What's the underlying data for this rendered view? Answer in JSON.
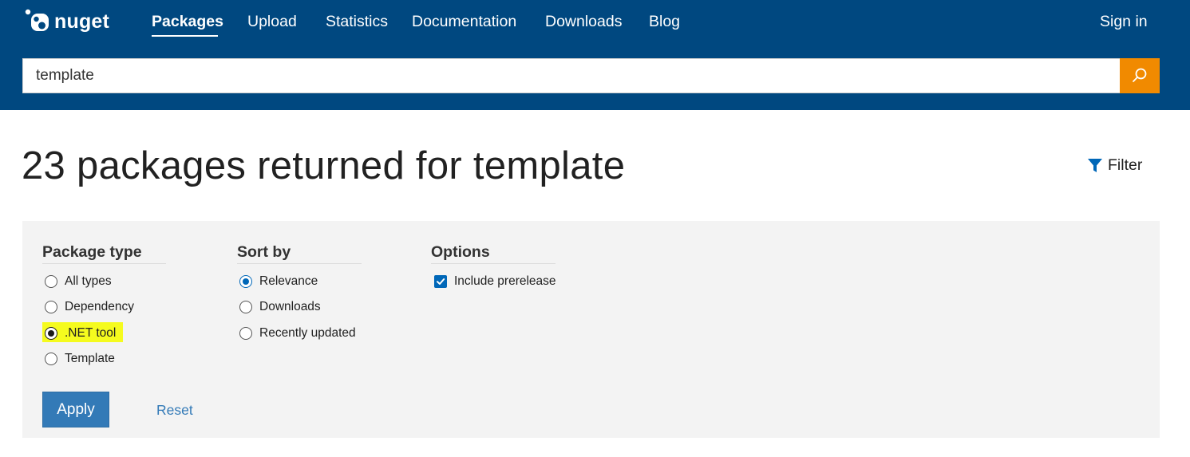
{
  "header": {
    "logo_text": "nuget",
    "nav": [
      {
        "label": "Packages",
        "active": true
      },
      {
        "label": "Upload",
        "active": false
      },
      {
        "label": "Statistics",
        "active": false
      },
      {
        "label": "Documentation",
        "active": false
      },
      {
        "label": "Downloads",
        "active": false
      },
      {
        "label": "Blog",
        "active": false
      }
    ],
    "sign_in": "Sign in",
    "search": {
      "value": "template",
      "button_icon": "search-icon"
    }
  },
  "results": {
    "title": "23 packages returned for template",
    "filter_label": "Filter"
  },
  "filters": {
    "package_type": {
      "title": "Package type",
      "options": [
        {
          "label": "All types",
          "selected": false
        },
        {
          "label": "Dependency",
          "selected": false
        },
        {
          "label": ".NET tool",
          "selected": true,
          "highlighted": true
        },
        {
          "label": "Template",
          "selected": false
        }
      ]
    },
    "sort_by": {
      "title": "Sort by",
      "options": [
        {
          "label": "Relevance",
          "selected": true
        },
        {
          "label": "Downloads",
          "selected": false
        },
        {
          "label": "Recently updated",
          "selected": false
        }
      ]
    },
    "options": {
      "title": "Options",
      "items": [
        {
          "label": "Include prerelease",
          "checked": true
        }
      ]
    },
    "apply_label": "Apply",
    "reset_label": "Reset"
  },
  "colors": {
    "header_bg": "#004880",
    "search_button": "#f18a00",
    "accent_blue": "#0067b8",
    "apply_button": "#337ab7",
    "highlight": "#f5fb1e"
  }
}
